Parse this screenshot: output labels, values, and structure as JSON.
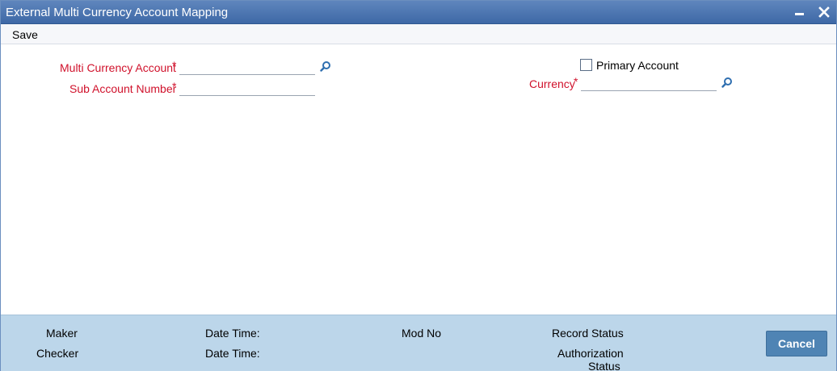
{
  "window": {
    "title": "External Multi Currency Account Mapping"
  },
  "menu": {
    "save_label": "Save"
  },
  "form": {
    "multi_currency_account": {
      "label": "Multi Currency Account",
      "required_mark": "*",
      "value": ""
    },
    "sub_account_number": {
      "label": "Sub Account Number",
      "required_mark": "*",
      "value": ""
    },
    "primary_account": {
      "label": "Primary Account",
      "checked": false
    },
    "currency": {
      "label": "Currency",
      "required_mark": "*",
      "value": ""
    }
  },
  "footer": {
    "maker_label": "Maker",
    "checker_label": "Checker",
    "date_time_label_1": "Date Time:",
    "date_time_label_2": "Date Time:",
    "mod_no_label": "Mod No",
    "record_status_label": "Record Status",
    "authorization_label": "Authorization",
    "status_label": "Status",
    "cancel_label": "Cancel"
  },
  "colors": {
    "title_bar": "#4a72ae",
    "required_label": "#d0112b",
    "footer_bg": "#bcd6ea",
    "cancel_button": "#4f84b4"
  }
}
